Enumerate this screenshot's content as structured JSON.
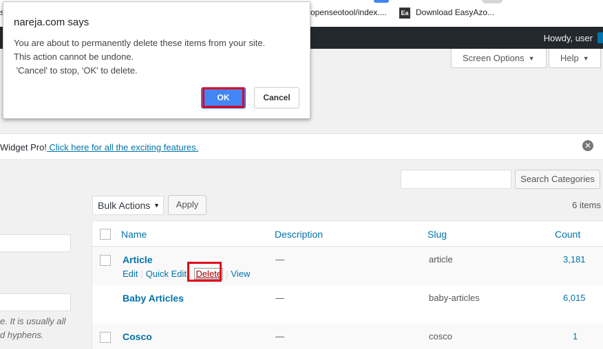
{
  "bookmarks": {
    "item1_text": "openseotool/index....",
    "item2_icon": "Ea",
    "item2_text": "Download EasyAzo...",
    "left_fragment": "s"
  },
  "adminbar": {
    "howdy": "Howdy, user"
  },
  "tabs": {
    "screen_options": "Screen Options",
    "help": "Help",
    "arrow": "▼"
  },
  "notice": {
    "text": "Widget Pro!",
    "link": " Click here for all the exciting features.",
    "close_icon": "✕"
  },
  "search": {
    "value": "",
    "button": "Search Categories"
  },
  "bulk": {
    "selected": "Bulk Actions",
    "apply": "Apply",
    "items_count": "6 items"
  },
  "left_form": {
    "desc_line1": "e. It is usually all",
    "desc_line2": "d hyphens."
  },
  "table": {
    "headers": {
      "name": "Name",
      "description": "Description",
      "slug": "Slug",
      "count": "Count"
    },
    "rows": [
      {
        "name": "Article",
        "description": "—",
        "slug": "article",
        "count": "3,181"
      },
      {
        "name": "Baby Articles",
        "description": "—",
        "slug": "baby-articles",
        "count": "6,015"
      },
      {
        "name": "Cosco",
        "description": "—",
        "slug": "cosco",
        "count": "1"
      }
    ],
    "row_actions": {
      "edit": "Edit",
      "quick_edit": "Quick Edit",
      "delete": "Delete",
      "view": "View",
      "separator": "|"
    }
  },
  "dialog": {
    "title": "nareja.com says",
    "message": "You are about to permanently delete these items from your site.\nThis action cannot be undone.\n 'Cancel' to stop, 'OK' to delete.",
    "ok": "OK",
    "cancel": "Cancel"
  },
  "colors": {
    "accent": "#0073aa",
    "ok_button": "#4285f4",
    "highlight": "#e0001a",
    "delete": "#a00000"
  }
}
